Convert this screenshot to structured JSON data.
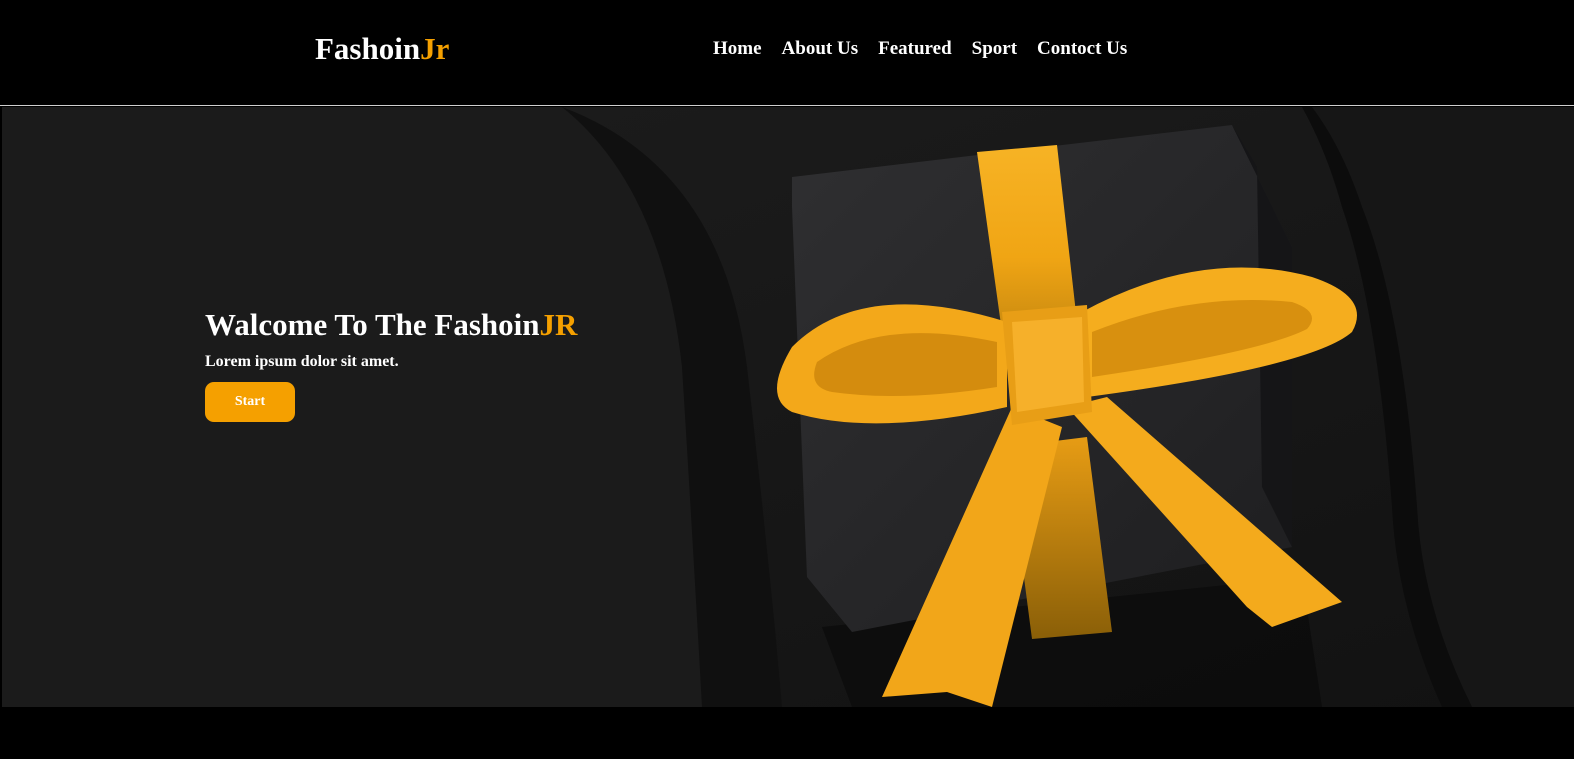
{
  "header": {
    "logo_main": "Fashoin",
    "logo_accent": "Jr",
    "nav": [
      {
        "label": "Home"
      },
      {
        "label": "About Us"
      },
      {
        "label": "Featured"
      },
      {
        "label": "Sport"
      },
      {
        "label": "Contoct Us"
      }
    ]
  },
  "hero": {
    "title_main": "Walcome To The Fashoin",
    "title_accent": "JR",
    "subtitle": "Lorem ipsum dolor sit amet.",
    "button_label": "Start",
    "image_description_icon": "gift-box-with-ribbon-image"
  },
  "colors": {
    "accent": "#f5a000",
    "background": "#000000",
    "text": "#ffffff"
  }
}
